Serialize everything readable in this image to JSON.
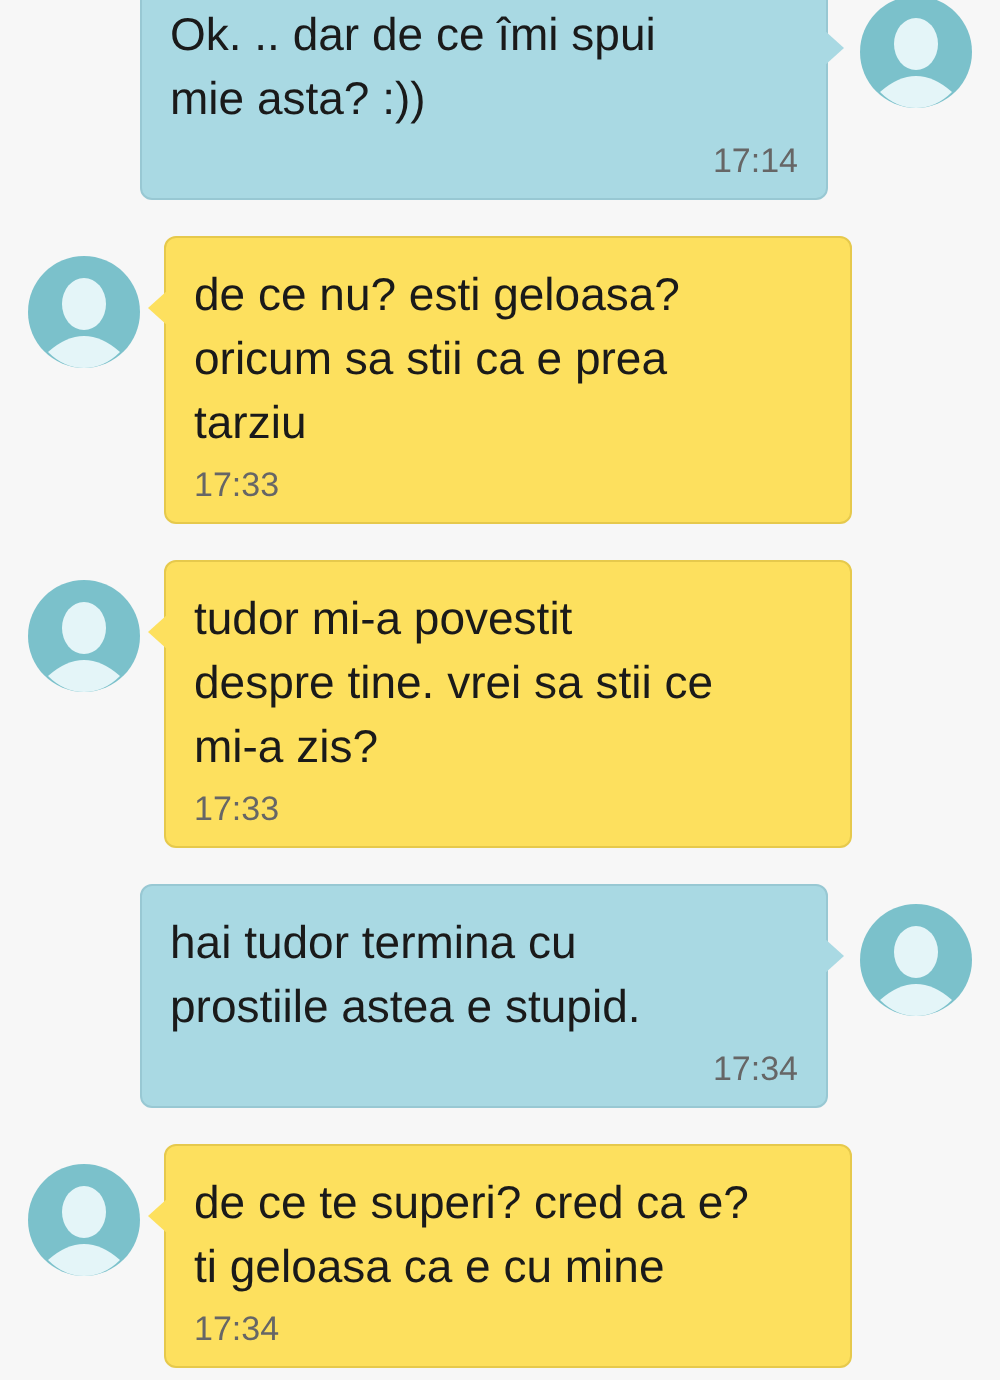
{
  "messages": [
    {
      "kind": "sent",
      "text": "Ok. .. dar de ce îmi spui\nmie asta?  :))",
      "time": "17:14"
    },
    {
      "kind": "received",
      "text": "de ce nu? esti geloasa?\noricum sa stii ca e prea\ntarziu",
      "time": "17:33"
    },
    {
      "kind": "received",
      "text": "tudor mi-a povestit\ndespre tine. vrei sa stii ce\nmi-a zis?",
      "time": "17:33"
    },
    {
      "kind": "sent",
      "text": "hai tudor termina cu\nprostiile astea e stupid.",
      "time": "17:34"
    },
    {
      "kind": "received",
      "text": "de ce te superi? cred ca e?\nti geloasa ca e cu mine",
      "time": "17:34"
    }
  ]
}
